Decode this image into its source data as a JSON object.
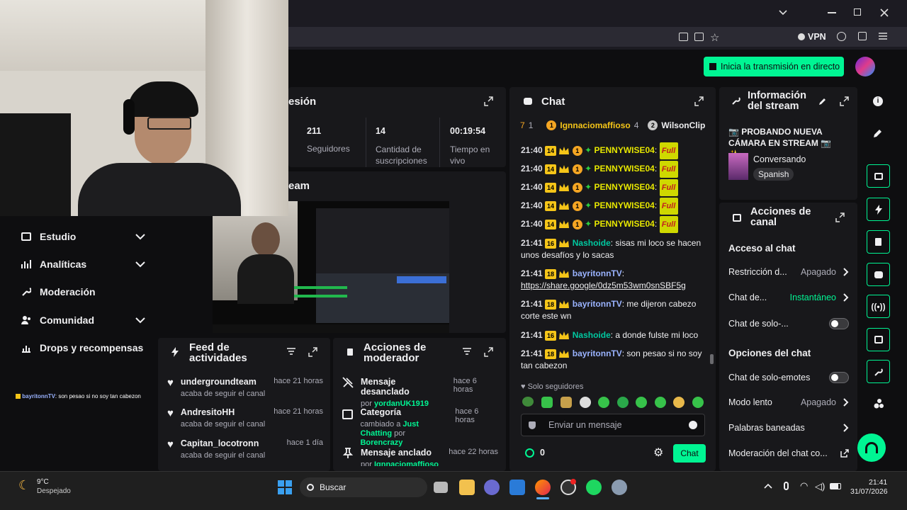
{
  "browser": {
    "vpn_label": "VPN"
  },
  "header": {
    "go_live_label": "Inicia la transmisión en directo"
  },
  "session": {
    "title_partial": "esión",
    "stats": [
      {
        "value": "211",
        "label": "Seguidores"
      },
      {
        "value": "14",
        "label": "Cantidad de suscripciones"
      },
      {
        "value": "00:19:54",
        "label": "Tiempo en vivo"
      }
    ]
  },
  "stream_preview": {
    "title_partial": "eam"
  },
  "nav": {
    "items": [
      {
        "label": "Estudio"
      },
      {
        "label": "Analíticas"
      },
      {
        "label": "Moderación"
      },
      {
        "label": "Comunidad"
      },
      {
        "label": "Drops y recompensas"
      }
    ]
  },
  "overlay_chat": {
    "nick": "bayritonnTV",
    "text": ": son pesao si no soy tan cabezon"
  },
  "feed": {
    "title": "Feed de actividades",
    "items": [
      {
        "name": "undergroundteam",
        "sub": "acaba de seguir el canal",
        "time": "hace 21 horas"
      },
      {
        "name": "AndresitoHH",
        "sub": "acaba de seguir el canal",
        "time": "hace 21 horas"
      },
      {
        "name": "Capitan_locotronn",
        "sub": "acaba de seguir el canal",
        "time": "hace 1 día"
      }
    ]
  },
  "mod_actions": {
    "title": "Acciones de moderador",
    "items": [
      {
        "title": "Mensaje desanclado",
        "by_prefix": "por ",
        "by": "yordanUK1919",
        "time": "hace 6 horas"
      },
      {
        "title": "Categoría",
        "by_prefix": "cambiado a ",
        "category": "Just Chatting",
        "mid": " por ",
        "by": "Borencrazy",
        "time": "hace 6 horas"
      },
      {
        "title": "Mensaje anclado",
        "by_prefix": "por ",
        "by": "Ignnaciomaffioso",
        "time": "hace 22 horas"
      }
    ]
  },
  "chat": {
    "title": "Chat",
    "leaderboard": {
      "rank1_left": "7",
      "rank1_left_num": "1",
      "first_name": "Ignnaciomaffioso",
      "first_count": "4",
      "second_name": "WilsonClip"
    },
    "messages": [
      {
        "time": "21:40",
        "badge": "14",
        "coin": "1",
        "nick": "PENNYWISE04",
        "emote": "Full"
      },
      {
        "time": "21:40",
        "badge": "14",
        "coin": "1",
        "nick": "PENNYWISE04",
        "emote": "Full"
      },
      {
        "time": "21:40",
        "badge": "14",
        "coin": "1",
        "nick": "PENNYWISE04",
        "emote": "Full"
      },
      {
        "time": "21:40",
        "badge": "14",
        "coin": "1",
        "nick": "PENNYWISE04",
        "emote": "Full"
      },
      {
        "time": "21:40",
        "badge": "14",
        "coin": "1",
        "nick": "PENNYWISE04",
        "emote": "Full"
      }
    ],
    "text_messages": [
      {
        "time": "21:41",
        "badge": "16",
        "nick": "Nashoide",
        "text": ": sisas mi loco se hacen unos desafíos y lo sacas"
      },
      {
        "time": "21:41",
        "badge": "18",
        "nick": "bayritonnTV",
        "text": ": ",
        "link": "https://share.google/0dz5m53wm0snSBF5g"
      },
      {
        "time": "21:41",
        "badge": "18",
        "nick": "bayritonnTV",
        "text": ": me dijeron cabezo corte este wn"
      },
      {
        "time": "21:41",
        "badge": "16",
        "nick": "Nashoide",
        "text": ": a donde fulste mi loco"
      },
      {
        "time": "21:41",
        "badge": "18",
        "nick": "bayritonnTV",
        "text": ": son pesao si no soy tan cabezon"
      }
    ],
    "followers_only": "Solo seguidores",
    "input_placeholder": "Enviar un mensaje",
    "points": "0",
    "send_label": "Chat"
  },
  "stream_info": {
    "title": "Información del stream",
    "stream_title": "📷 PROBANDO NUEVA CÁMARA EN STREAM 📷 ✨...",
    "category": "Conversando",
    "language": "Spanish"
  },
  "channel_actions": {
    "title": "Acciones de canal",
    "section1": "Acceso al chat",
    "rows1": [
      {
        "label": "Restricción d...",
        "value": "Apagado"
      },
      {
        "label": "Chat de...",
        "value": "Instantáneo"
      },
      {
        "label": "Chat de solo-..."
      }
    ],
    "section2": "Opciones del chat",
    "rows2": [
      {
        "label": "Chat de solo-emotes"
      },
      {
        "label": "Modo lento",
        "value": "Apagado"
      },
      {
        "label": "Palabras baneadas"
      },
      {
        "label": "Moderación del chat co..."
      }
    ]
  },
  "taskbar": {
    "weather_temp": "9°C",
    "weather_desc": "Despejado",
    "search_label": "Buscar",
    "time": "21:41",
    "date": "31/07/2026"
  },
  "colors": {
    "accent": "#00f593",
    "panel": "#18181b",
    "bg": "#0e0e10"
  }
}
